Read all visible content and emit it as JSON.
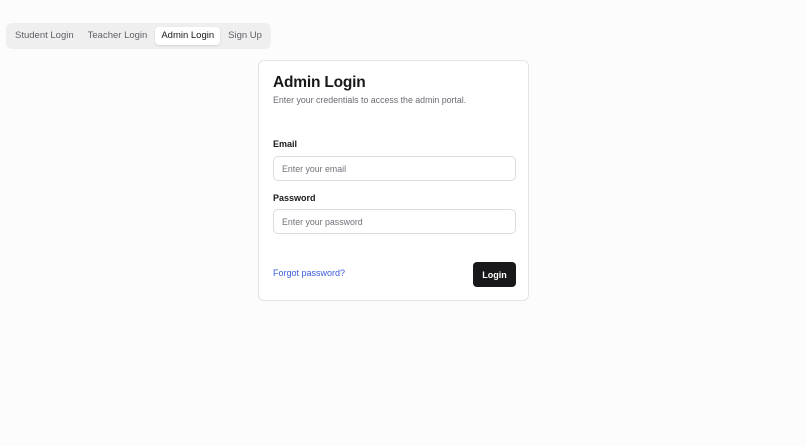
{
  "tabs": [
    {
      "label": "Student Login",
      "active": false
    },
    {
      "label": "Teacher Login",
      "active": false
    },
    {
      "label": "Admin Login",
      "active": true
    },
    {
      "label": "Sign Up",
      "active": false
    }
  ],
  "card": {
    "title": "Admin Login",
    "subtitle": "Enter your credentials to access the admin portal.",
    "email": {
      "label": "Email",
      "placeholder": "Enter your email",
      "value": ""
    },
    "password": {
      "label": "Password",
      "placeholder": "Enter your password",
      "value": ""
    },
    "forgot_link": "Forgot password?",
    "submit_label": "Login"
  },
  "colors": {
    "background": "#fcfcfc",
    "primary_button": "#18181b",
    "link": "#3b5bdb",
    "border": "#e4e4e7"
  }
}
